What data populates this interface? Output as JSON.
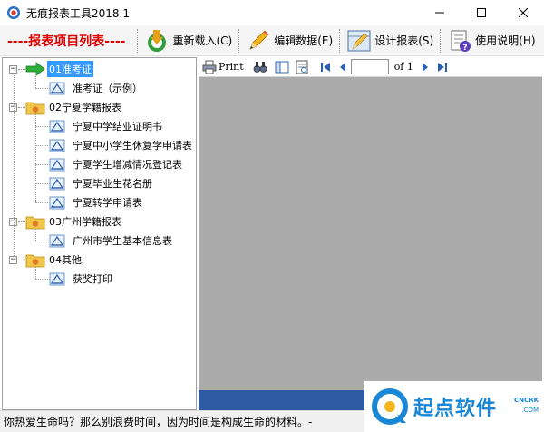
{
  "window": {
    "title": "无痕报表工具2018.1"
  },
  "toolbar": {
    "section_title": "----报表项目列表----",
    "reload_label": "重新载入(C)",
    "edit_data_label": "编辑数据(E)",
    "design_report_label": "设计报表(S)",
    "help_label": "使用说明(H)"
  },
  "tree": {
    "groups": [
      {
        "label": "01准考证",
        "selected": true,
        "items": [
          "准考证（示例）"
        ]
      },
      {
        "label": "02宁夏学籍报表",
        "items": [
          "宁夏中学结业证明书",
          "宁夏中小学生休复学申请表",
          "宁夏学生增减情况登记表",
          "宁夏毕业生花名册",
          "宁夏转学申请表"
        ]
      },
      {
        "label": "03广州学籍报表",
        "items": [
          "广州市学生基本信息表"
        ]
      },
      {
        "label": "04其他",
        "items": [
          "获奖打印"
        ]
      }
    ]
  },
  "viewer": {
    "print_label": "Print",
    "page_of_label": "of 1",
    "page_value": ""
  },
  "status": {
    "text": "你热爱生命吗？那么别浪费时间，因为时间是构成生命的材料。-"
  },
  "watermark": {
    "brand": "起点软件",
    "tag": "CNCRK",
    "domain": ".COM"
  },
  "colors": {
    "selection": "#3399ff",
    "section_title": "#e00000",
    "viewer_background": "#ababab",
    "viewer_bottom": "#2d5aa2",
    "watermark": "#1a86d6"
  }
}
